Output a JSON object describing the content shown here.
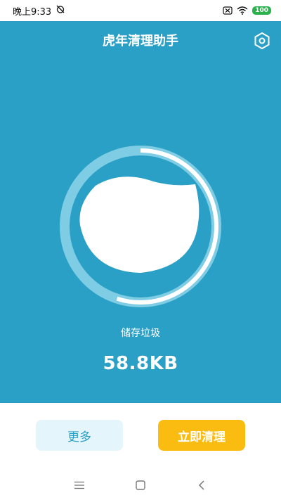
{
  "status_bar": {
    "time": "晚上9:33",
    "battery": "100",
    "icons": [
      "alarm-off-icon",
      "sim-off-icon",
      "wifi-icon",
      "battery-icon"
    ]
  },
  "header": {
    "title": "虎年清理助手",
    "settings_icon": "settings-hexagon-icon"
  },
  "gauge": {
    "progress": 0.55
  },
  "storage": {
    "label": "储存垃圾",
    "value": "58.8KB"
  },
  "actions": {
    "more_label": "更多",
    "clean_label": "立即清理"
  },
  "nav": {
    "icons": [
      "menu-icon",
      "home-icon",
      "back-icon"
    ]
  },
  "colors": {
    "primary": "#2aa0c6",
    "accent": "#fbbc12",
    "more_bg": "#e4f6fb"
  }
}
